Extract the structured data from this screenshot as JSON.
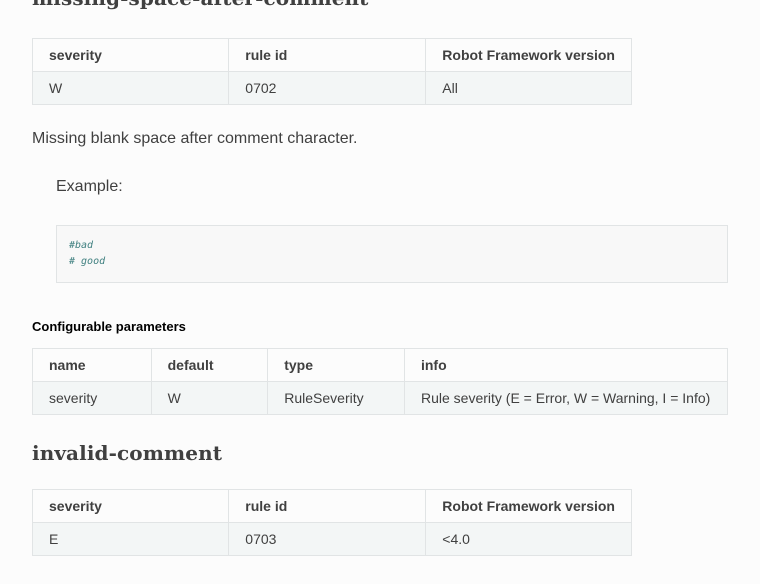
{
  "rules": [
    {
      "title": "missing-space-after-comment",
      "table": {
        "headers": [
          "severity",
          "rule id",
          "Robot Framework version"
        ],
        "row": [
          "W",
          "0702",
          "All"
        ]
      },
      "description": "Missing blank space after comment character.",
      "example_label": "Example:",
      "code_lines": [
        "#bad",
        "# good"
      ]
    },
    {
      "title": "invalid-comment",
      "table": {
        "headers": [
          "severity",
          "rule id",
          "Robot Framework version"
        ],
        "row": [
          "E",
          "0703",
          "<4.0"
        ]
      }
    }
  ],
  "configurable": {
    "heading": "Configurable parameters",
    "headers": [
      "name",
      "default",
      "type",
      "info"
    ],
    "row": [
      "severity",
      "W",
      "RuleSeverity",
      "Rule severity (E = Error, W = Warning, I = Info)"
    ]
  },
  "colors": {
    "text": "#404040",
    "border": "#e1e4e5",
    "cell_bg": "#f3f6f6",
    "code_comment": "#408080"
  }
}
